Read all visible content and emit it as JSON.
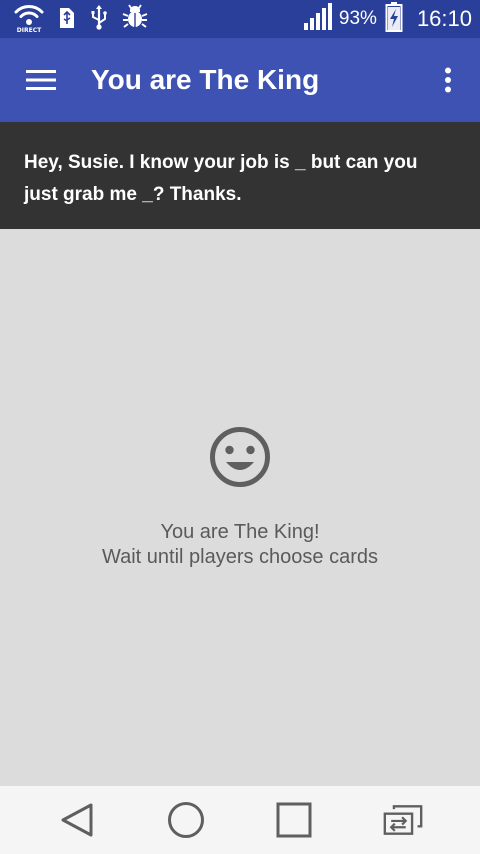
{
  "status_bar": {
    "direct_label": "DIRECT",
    "battery_percent": "93%",
    "time": "16:10",
    "icons": [
      "wifi-direct-icon",
      "usb-storage-icon",
      "usb-icon",
      "debug-bug-icon",
      "signal-icon",
      "battery-charging-icon"
    ]
  },
  "app_bar": {
    "title": "You are The King",
    "menu_icon": "hamburger-menu-icon",
    "overflow_icon": "more-vert-icon"
  },
  "question_card": {
    "text": "Hey, Susie. I know your job is _ but can you just grab me _? Thanks."
  },
  "waiting": {
    "icon": "smiley-face-icon",
    "line1": "You are The King!",
    "line2": "Wait until players choose cards"
  },
  "nav_bar": {
    "icons": [
      "back-icon",
      "home-icon",
      "recents-icon",
      "dual-window-icon"
    ]
  },
  "colors": {
    "status_bar": "#2a3f9a",
    "app_bar": "#3d52b3",
    "card_bg": "#333333",
    "main_bg": "#dcdcdc",
    "nav_bg": "#f5f5f5",
    "icon_grey": "#5f5f5f"
  }
}
